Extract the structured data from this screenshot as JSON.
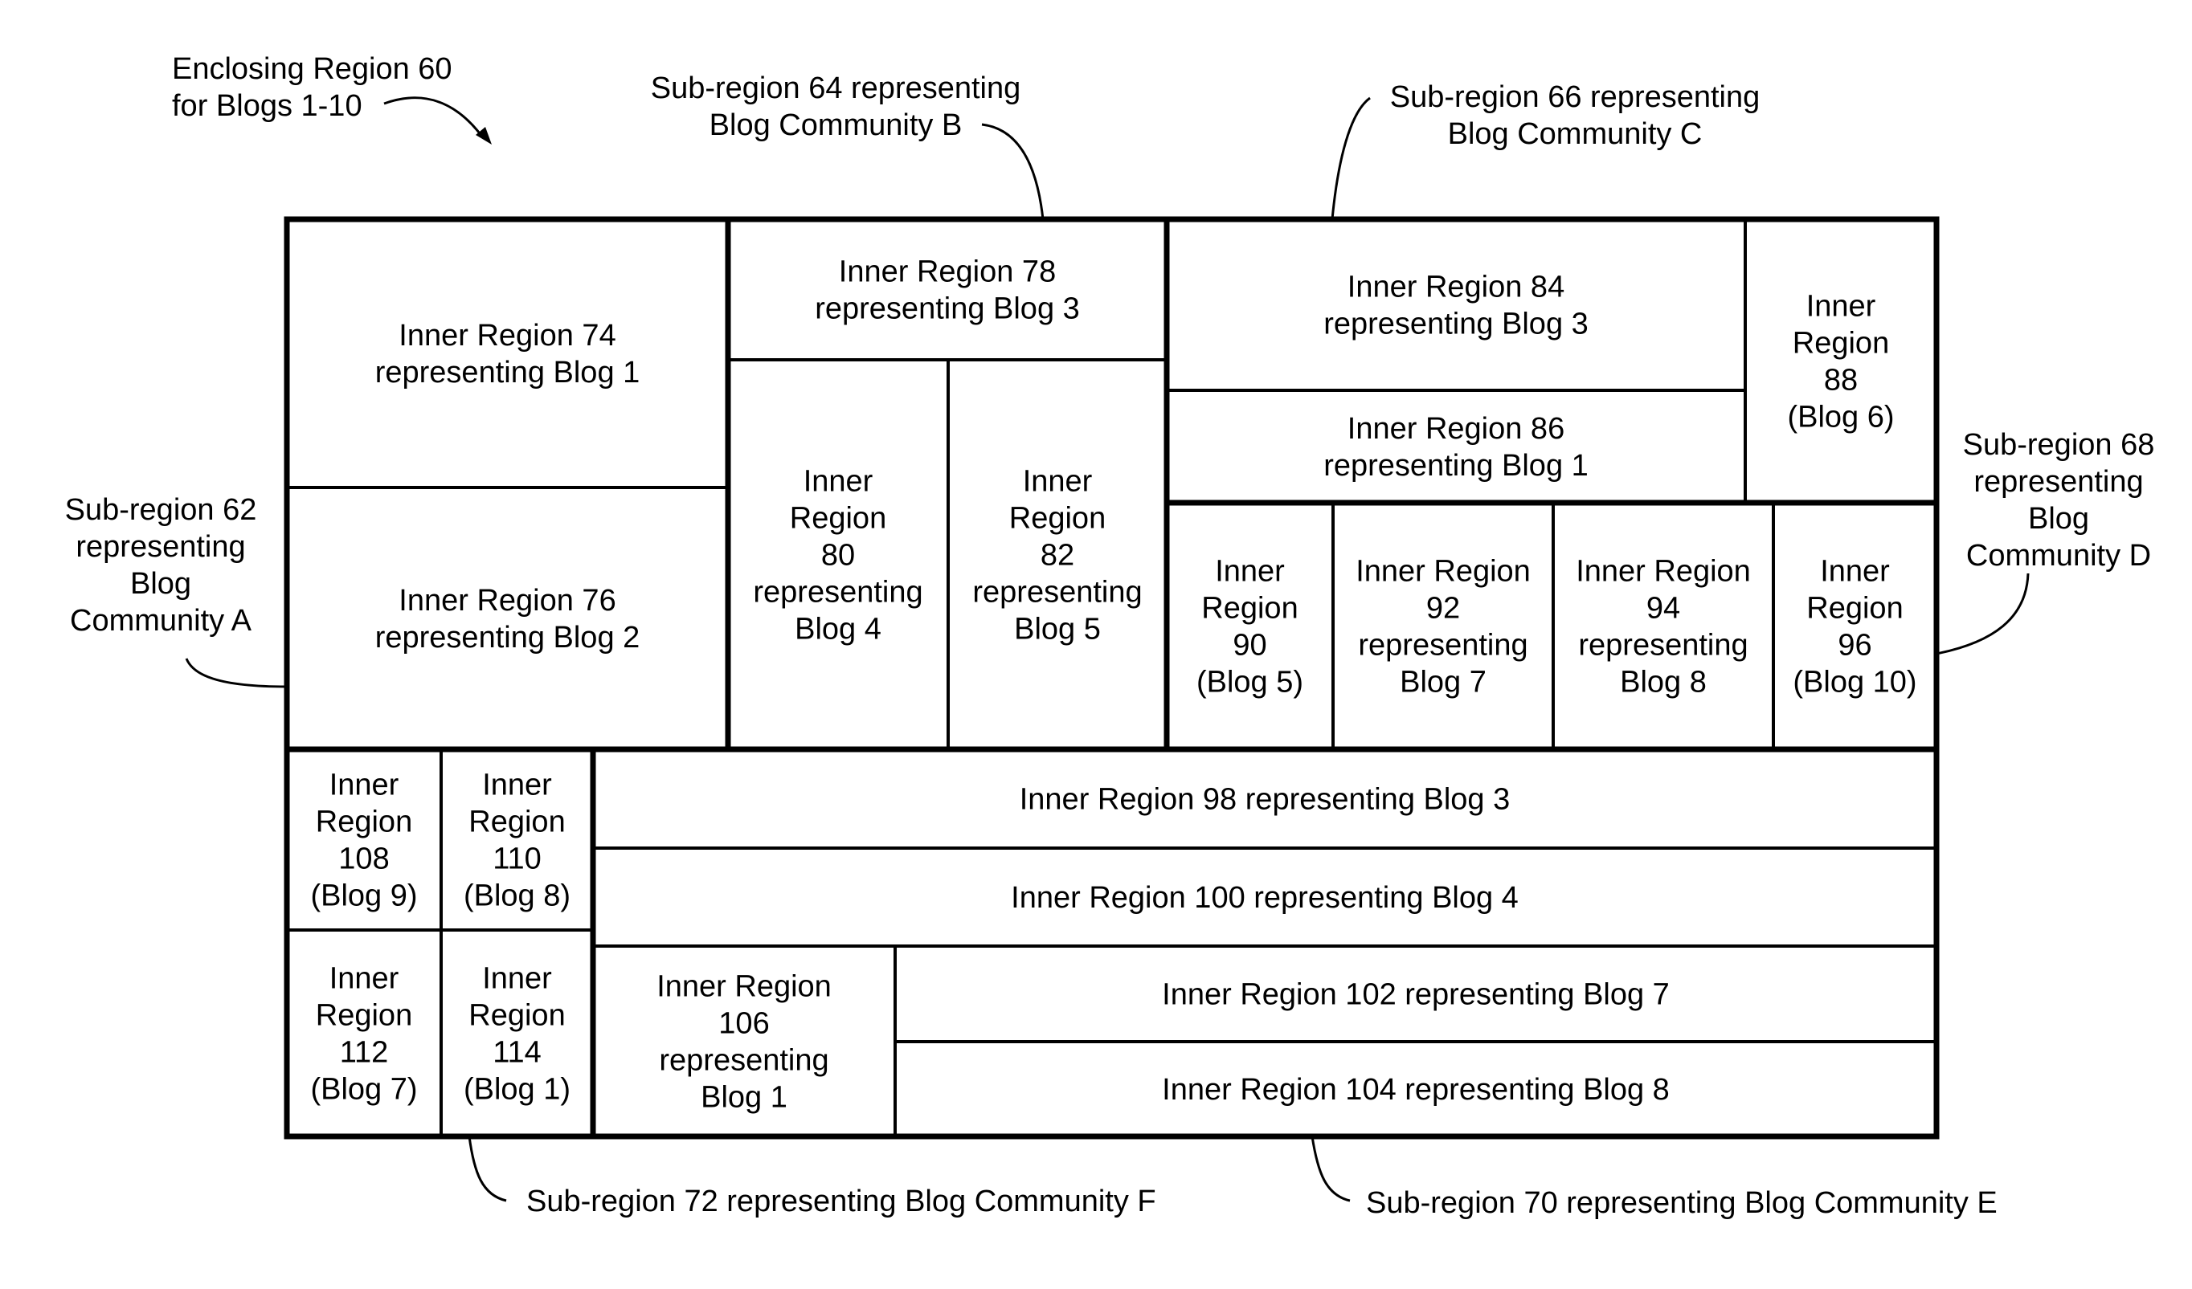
{
  "figure": {
    "enclosing_label": [
      "Enclosing Region 60",
      "for Blogs 1-10"
    ],
    "callouts": {
      "A": [
        "Sub-region 62",
        "representing",
        "Blog",
        "Community A"
      ],
      "B": [
        "Sub-region 64 representing",
        "Blog Community B"
      ],
      "C": [
        "Sub-region 66 representing",
        "Blog Community C"
      ],
      "D": [
        "Sub-region 68",
        "representing",
        "Blog",
        "Community D"
      ],
      "E": [
        "Sub-region 70 representing Blog Community E"
      ],
      "F": [
        "Sub-region 72 representing Blog Community F"
      ]
    },
    "regions": {
      "r74": [
        "Inner Region 74",
        "representing Blog 1"
      ],
      "r76": [
        "Inner Region 76",
        "representing Blog 2"
      ],
      "r78": [
        "Inner Region 78",
        "representing Blog 3"
      ],
      "r80": [
        "Inner",
        "Region",
        "80",
        "representing",
        "Blog 4"
      ],
      "r82": [
        "Inner",
        "Region",
        "82",
        "representing",
        "Blog 5"
      ],
      "r84": [
        "Inner Region 84",
        "representing Blog 3"
      ],
      "r86": [
        "Inner Region 86",
        "representing Blog 1"
      ],
      "r88": [
        "Inner",
        "Region",
        "88",
        "(Blog 6)"
      ],
      "r90": [
        "Inner",
        "Region",
        "90",
        "(Blog 5)"
      ],
      "r92": [
        "Inner Region",
        "92",
        "representing",
        "Blog 7"
      ],
      "r94": [
        "Inner Region",
        "94",
        "representing",
        "Blog 8"
      ],
      "r96": [
        "Inner",
        "Region",
        "96",
        "(Blog 10)"
      ],
      "r98": [
        "Inner Region 98 representing Blog 3"
      ],
      "r100": [
        "Inner Region 100 representing Blog 4"
      ],
      "r102": [
        "Inner Region 102 representing Blog 7"
      ],
      "r104": [
        "Inner Region 104 representing Blog 8"
      ],
      "r106": [
        "Inner Region",
        "106",
        "representing",
        "Blog 1"
      ],
      "r108": [
        "Inner",
        "Region",
        "108",
        "(Blog 9)"
      ],
      "r110": [
        "Inner",
        "Region",
        "110",
        "(Blog 8)"
      ],
      "r112": [
        "Inner",
        "Region",
        "112",
        "(Blog 7)"
      ],
      "r114": [
        "Inner",
        "Region",
        "114",
        "(Blog 1)"
      ]
    }
  }
}
